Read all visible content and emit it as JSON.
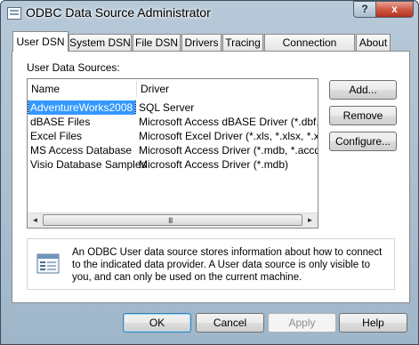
{
  "window": {
    "title": "ODBC Data Source Administrator",
    "help_glyph": "?",
    "close_glyph": "x"
  },
  "tabs": [
    {
      "label": "User DSN",
      "active": true
    },
    {
      "label": "System DSN",
      "active": false
    },
    {
      "label": "File DSN",
      "active": false
    },
    {
      "label": "Drivers",
      "active": false
    },
    {
      "label": "Tracing",
      "active": false
    },
    {
      "label": "Connection Pooling",
      "active": false
    },
    {
      "label": "About",
      "active": false
    }
  ],
  "section": {
    "label": "User Data Sources:"
  },
  "list": {
    "columns": [
      "Name",
      "Driver"
    ],
    "rows": [
      {
        "name": "AdventureWorks2008",
        "driver": "SQL Server",
        "selected": true
      },
      {
        "name": "dBASE Files",
        "driver": "Microsoft Access dBASE Driver (*.dbf, *.nd",
        "selected": false
      },
      {
        "name": "Excel Files",
        "driver": "Microsoft Excel Driver (*.xls, *.xlsx, *.xlsm,",
        "selected": false
      },
      {
        "name": "MS Access Database",
        "driver": "Microsoft Access Driver (*.mdb, *.accdb)",
        "selected": false
      },
      {
        "name": "Visio Database Samples",
        "driver": "Microsoft Access Driver (*.mdb)",
        "selected": false
      }
    ],
    "scroll_left": "◄",
    "scroll_right": "►",
    "scroll_grip": "III"
  },
  "side_buttons": {
    "add": "Add...",
    "remove": "Remove",
    "configure": "Configure..."
  },
  "info": {
    "text": "An ODBC User data source stores information about how to connect to the indicated data provider.  A User data source is only visible to you, and can only be used on the current machine."
  },
  "bottom_buttons": {
    "ok": "OK",
    "cancel": "Cancel",
    "apply": "Apply",
    "help": "Help"
  },
  "colors": {
    "selection": "#3399ff",
    "frame": "#a8bdcf",
    "close": "#c8462e"
  }
}
